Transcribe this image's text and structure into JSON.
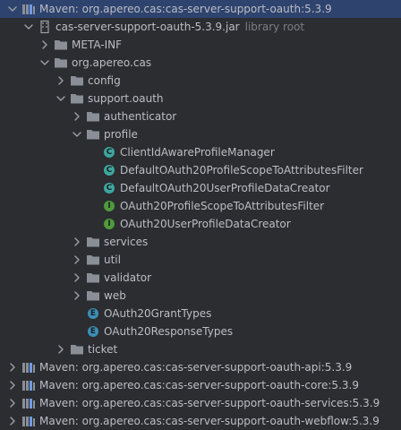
{
  "colors": {
    "folder": "#8a8f97",
    "class": "#3ca7a0",
    "interface": "#4f9a3c",
    "enum": "#3b8fb6",
    "maven_library": "#6f9ae8",
    "selection": "#2e436e"
  },
  "tree": {
    "root": {
      "label": "Maven: org.apereo.cas:cas-server-support-oauth:5.3.9",
      "icon": "library-icon"
    },
    "jar": {
      "label": "cas-server-support-oauth-5.3.9.jar",
      "hint": "library root",
      "icon": "jar-icon"
    },
    "meta_inf": {
      "label": "META-INF",
      "icon": "folder-icon"
    },
    "package_root": {
      "label": "org.apereo.cas",
      "icon": "folder-icon"
    },
    "config": {
      "label": "config",
      "icon": "folder-icon"
    },
    "support_oauth": {
      "label": "support.oauth",
      "icon": "folder-icon"
    },
    "authenticator": {
      "label": "authenticator",
      "icon": "folder-icon"
    },
    "profile": {
      "label": "profile",
      "icon": "folder-icon"
    },
    "profile_items": [
      {
        "label": "ClientIdAwareProfileManager",
        "icon": "class-icon",
        "badge": "C"
      },
      {
        "label": "DefaultOAuth20ProfileScopeToAttributesFilter",
        "icon": "class-icon",
        "badge": "C"
      },
      {
        "label": "DefaultOAuth20UserProfileDataCreator",
        "icon": "class-icon",
        "badge": "C"
      },
      {
        "label": "OAuth20ProfileScopeToAttributesFilter",
        "icon": "interface-icon",
        "badge": "I"
      },
      {
        "label": "OAuth20UserProfileDataCreator",
        "icon": "interface-icon",
        "badge": "I"
      }
    ],
    "services": {
      "label": "services",
      "icon": "folder-icon"
    },
    "util": {
      "label": "util",
      "icon": "folder-icon"
    },
    "validator": {
      "label": "validator",
      "icon": "folder-icon"
    },
    "web": {
      "label": "web",
      "icon": "folder-icon"
    },
    "enums": [
      {
        "label": "OAuth20GrantTypes",
        "icon": "enum-icon",
        "badge": "E"
      },
      {
        "label": "OAuth20ResponseTypes",
        "icon": "enum-icon",
        "badge": "E"
      }
    ],
    "ticket": {
      "label": "ticket",
      "icon": "folder-icon"
    },
    "other_libraries": [
      {
        "label": "Maven: org.apereo.cas:cas-server-support-oauth-api:5.3.9",
        "icon": "library-icon"
      },
      {
        "label": "Maven: org.apereo.cas:cas-server-support-oauth-core:5.3.9",
        "icon": "library-icon"
      },
      {
        "label": "Maven: org.apereo.cas:cas-server-support-oauth-services:5.3.9",
        "icon": "library-icon"
      },
      {
        "label": "Maven: org.apereo.cas:cas-server-support-oauth-webflow:5.3.9",
        "icon": "library-icon"
      }
    ]
  }
}
